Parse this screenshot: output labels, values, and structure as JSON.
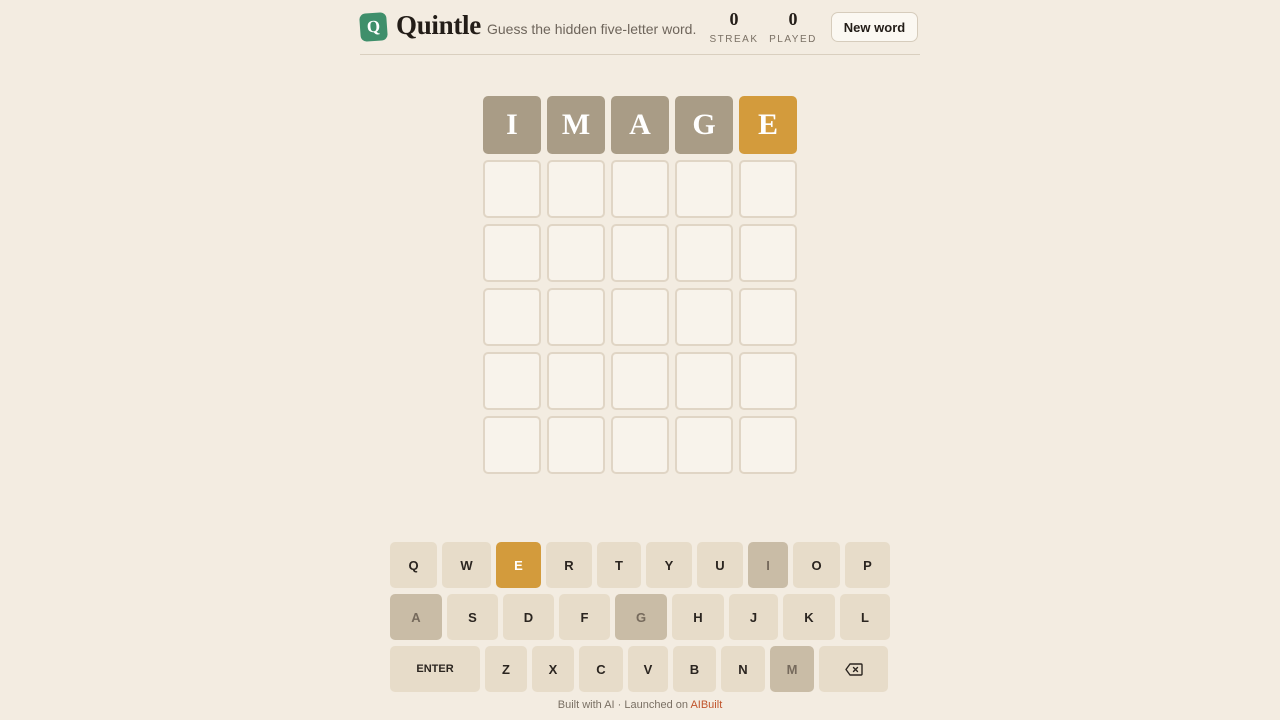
{
  "app": {
    "logo_letter": "Q",
    "title": "Quintle",
    "tagline": "Guess the hidden five-letter word."
  },
  "stats": {
    "streak_value": "0",
    "streak_label": "STREAK",
    "played_value": "0",
    "played_label": "PLAYED"
  },
  "new_word_label": "New word",
  "colors": {
    "absent": "#a99c86",
    "present": "#d39b3c",
    "empty": "#f8f3eb",
    "logo": "#3f8f6b"
  },
  "board": [
    [
      {
        "letter": "I",
        "state": "absent"
      },
      {
        "letter": "M",
        "state": "absent"
      },
      {
        "letter": "A",
        "state": "absent"
      },
      {
        "letter": "G",
        "state": "absent"
      },
      {
        "letter": "E",
        "state": "present"
      }
    ],
    [
      {
        "letter": "",
        "state": "empty"
      },
      {
        "letter": "",
        "state": "empty"
      },
      {
        "letter": "",
        "state": "empty"
      },
      {
        "letter": "",
        "state": "empty"
      },
      {
        "letter": "",
        "state": "empty"
      }
    ],
    [
      {
        "letter": "",
        "state": "empty"
      },
      {
        "letter": "",
        "state": "empty"
      },
      {
        "letter": "",
        "state": "empty"
      },
      {
        "letter": "",
        "state": "empty"
      },
      {
        "letter": "",
        "state": "empty"
      }
    ],
    [
      {
        "letter": "",
        "state": "empty"
      },
      {
        "letter": "",
        "state": "empty"
      },
      {
        "letter": "",
        "state": "empty"
      },
      {
        "letter": "",
        "state": "empty"
      },
      {
        "letter": "",
        "state": "empty"
      }
    ],
    [
      {
        "letter": "",
        "state": "empty"
      },
      {
        "letter": "",
        "state": "empty"
      },
      {
        "letter": "",
        "state": "empty"
      },
      {
        "letter": "",
        "state": "empty"
      },
      {
        "letter": "",
        "state": "empty"
      }
    ],
    [
      {
        "letter": "",
        "state": "empty"
      },
      {
        "letter": "",
        "state": "empty"
      },
      {
        "letter": "",
        "state": "empty"
      },
      {
        "letter": "",
        "state": "empty"
      },
      {
        "letter": "",
        "state": "empty"
      }
    ]
  ],
  "keyboard": {
    "row1": [
      {
        "label": "Q",
        "state": "unused"
      },
      {
        "label": "W",
        "state": "unused"
      },
      {
        "label": "E",
        "state": "present"
      },
      {
        "label": "R",
        "state": "unused"
      },
      {
        "label": "T",
        "state": "unused"
      },
      {
        "label": "Y",
        "state": "unused"
      },
      {
        "label": "U",
        "state": "unused"
      },
      {
        "label": "I",
        "state": "absent"
      },
      {
        "label": "O",
        "state": "unused"
      },
      {
        "label": "P",
        "state": "unused"
      }
    ],
    "row2": [
      {
        "label": "A",
        "state": "absent"
      },
      {
        "label": "S",
        "state": "unused"
      },
      {
        "label": "D",
        "state": "unused"
      },
      {
        "label": "F",
        "state": "unused"
      },
      {
        "label": "G",
        "state": "absent"
      },
      {
        "label": "H",
        "state": "unused"
      },
      {
        "label": "J",
        "state": "unused"
      },
      {
        "label": "K",
        "state": "unused"
      },
      {
        "label": "L",
        "state": "unused"
      }
    ],
    "row3": [
      {
        "label": "ENTER",
        "state": "unused",
        "icon": ""
      },
      {
        "label": "Z",
        "state": "unused"
      },
      {
        "label": "X",
        "state": "unused"
      },
      {
        "label": "C",
        "state": "unused"
      },
      {
        "label": "V",
        "state": "unused"
      },
      {
        "label": "B",
        "state": "unused"
      },
      {
        "label": "N",
        "state": "unused"
      },
      {
        "label": "M",
        "state": "absent"
      },
      {
        "label": "",
        "state": "unused",
        "icon": "backspace-icon"
      }
    ]
  },
  "footer": {
    "text": "Built with AI · Launched on",
    "link": "AIBuilt"
  }
}
